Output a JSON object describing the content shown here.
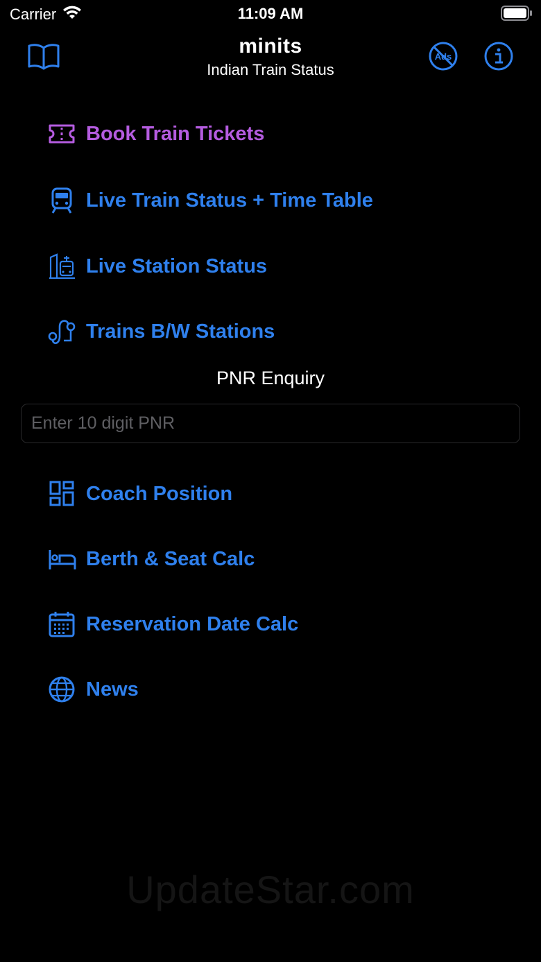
{
  "status_bar": {
    "carrier": "Carrier",
    "time": "11:09 AM"
  },
  "nav": {
    "title": "minits",
    "subtitle": "Indian Train Status",
    "noads_text": "Ads"
  },
  "colors": {
    "accent": "#2f80ed",
    "purple": "#b55ce0",
    "background": "#000000"
  },
  "menu": {
    "book_tickets": "Book Train Tickets",
    "live_train": "Live Train Status + Time Table",
    "live_station": "Live Station Status",
    "trains_between": "Trains B/W Stations",
    "coach_position": "Coach Position",
    "berth_calc": "Berth & Seat Calc",
    "reservation_calc": "Reservation Date Calc",
    "news": "News"
  },
  "pnr": {
    "title": "PNR Enquiry",
    "placeholder": "Enter 10 digit PNR",
    "value": ""
  },
  "watermark": "UpdateStar.com"
}
